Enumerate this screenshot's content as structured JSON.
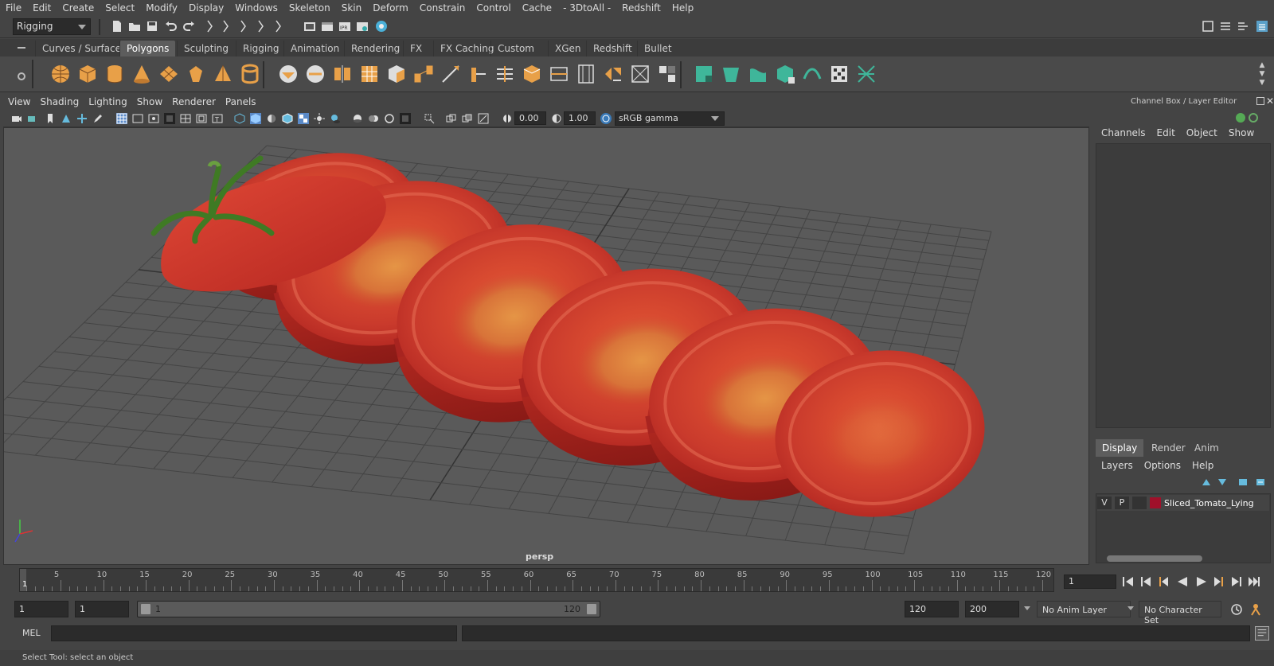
{
  "menubar": [
    "File",
    "Edit",
    "Create",
    "Select",
    "Modify",
    "Display",
    "Windows",
    "Skeleton",
    "Skin",
    "Deform",
    "Constrain",
    "Control",
    "Cache",
    "- 3DtoAll -",
    "Redshift",
    "Help"
  ],
  "status": {
    "mode": "Rigging"
  },
  "shelf_tabs": [
    "Curves / Surfaces",
    "Polygons",
    "Sculpting",
    "Rigging",
    "Animation",
    "Rendering",
    "FX",
    "FX Caching",
    "Custom",
    "XGen",
    "Redshift",
    "Bullet"
  ],
  "shelf_active": "Polygons",
  "panel_menu": [
    "View",
    "Shading",
    "Lighting",
    "Show",
    "Renderer",
    "Panels"
  ],
  "viewport_toolbar": {
    "exposure": "0.00",
    "gamma": "1.00",
    "color_space": "sRGB gamma"
  },
  "viewport": {
    "camera": "persp"
  },
  "channel_box": {
    "title": "Channel Box / Layer Editor",
    "menu": [
      "Channels",
      "Edit",
      "Object",
      "Show"
    ]
  },
  "layer_editor": {
    "tabs": [
      "Display",
      "Render",
      "Anim"
    ],
    "active_tab": "Display",
    "menu": [
      "Layers",
      "Options",
      "Help"
    ],
    "layers": [
      {
        "visible": "V",
        "playback": "P",
        "name": "Sliced_Tomato_Lying",
        "color": "#a0102a"
      }
    ]
  },
  "timeline": {
    "ticks": [
      "5",
      "10",
      "15",
      "20",
      "25",
      "30",
      "35",
      "40",
      "45",
      "50",
      "55",
      "60",
      "65",
      "70",
      "75",
      "80",
      "85",
      "90",
      "95",
      "100",
      "105",
      "110",
      "115",
      "120"
    ],
    "start_marker": "1",
    "current_frame": "1"
  },
  "range": {
    "anim_start": "1",
    "playback_start": "1",
    "range_min": "1",
    "range_max": "120",
    "playback_end": "120",
    "anim_end": "200",
    "anim_layer": "No Anim Layer",
    "character_set": "No Character Set"
  },
  "command_line": {
    "label": "MEL"
  },
  "help_line": "Select Tool: select an object",
  "colors": {
    "tomato": "#c62a24",
    "shelf_icon": "#e8a048",
    "shelf_teal": "#3fb69a"
  }
}
